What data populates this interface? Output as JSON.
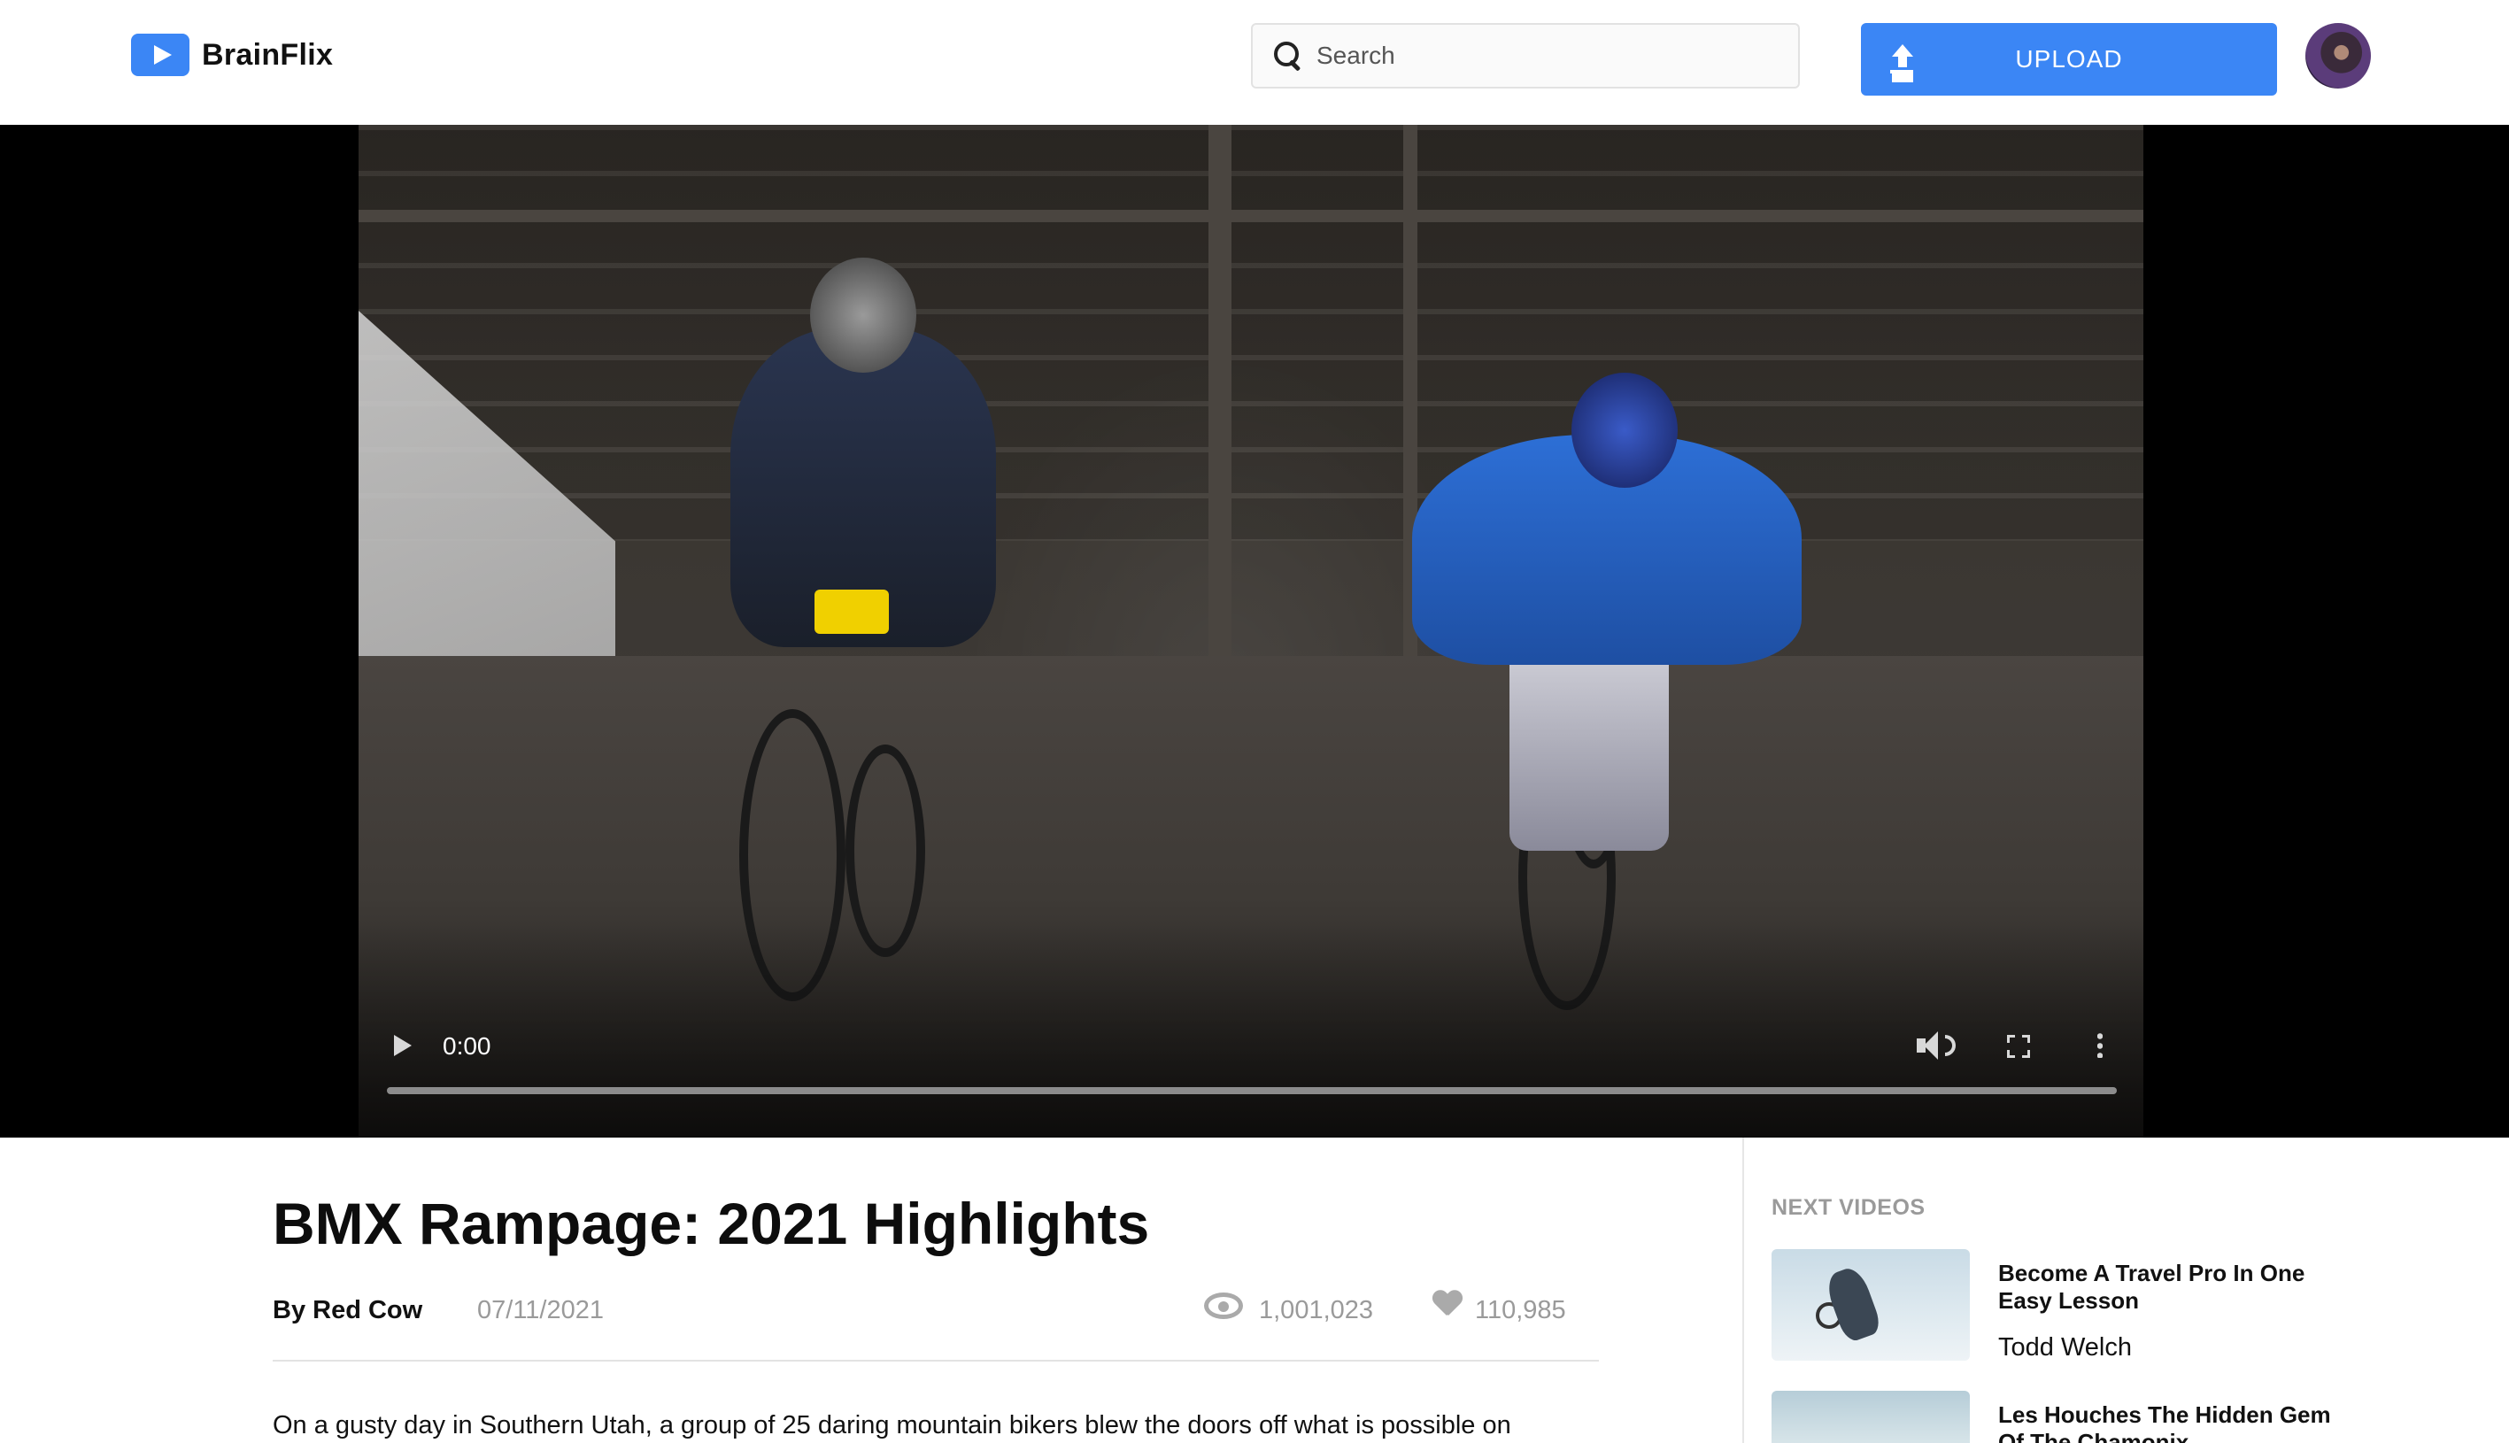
{
  "app": {
    "name": "BrainFlix",
    "accent_color": "#3b86f5"
  },
  "header": {
    "search_placeholder": "Search",
    "upload_label": "UPLOAD",
    "upload_icon": "upload-icon",
    "search_icon": "search-icon",
    "avatar": "user-avatar"
  },
  "player": {
    "current_time": "0:00",
    "progress": 0,
    "icons": [
      "play-icon",
      "volume-icon",
      "fullscreen-icon",
      "more-vert-icon"
    ]
  },
  "video": {
    "title": "BMX Rampage: 2021 Highlights",
    "author": "By Red Cow",
    "date": "07/11/2021",
    "views": "1,001,023",
    "likes": "110,985",
    "description": "On a gusty day in Southern Utah, a group of 25 daring mountain bikers blew the doors off what is possible on"
  },
  "sidebar": {
    "heading": "NEXT VIDEOS",
    "items": [
      {
        "title": "Become A Travel Pro In One Easy Lesson",
        "author": "Todd Welch"
      },
      {
        "title": "Les Houches The Hidden Gem Of The Chamonix",
        "author": ""
      }
    ]
  }
}
